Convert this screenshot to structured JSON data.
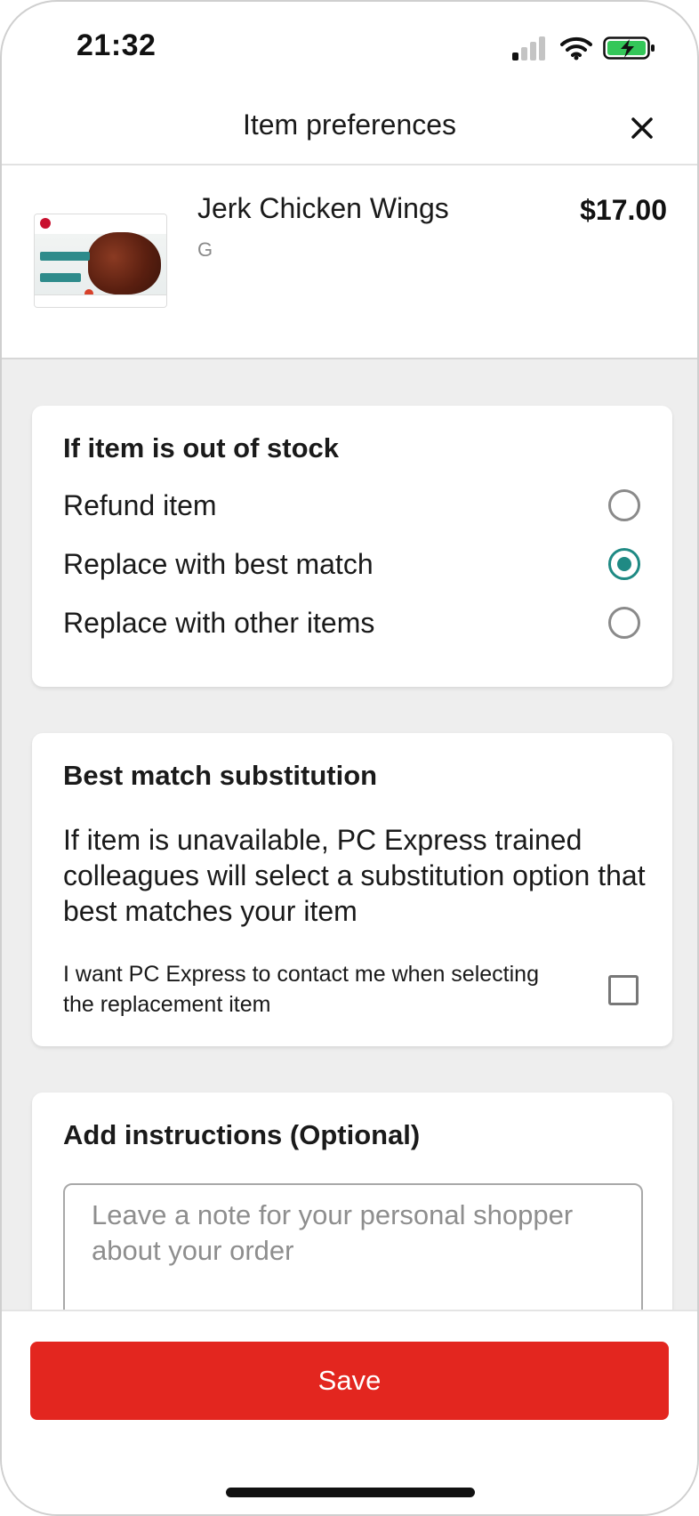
{
  "status_bar": {
    "time": "21:32",
    "icons": [
      "cellular-signal-icon",
      "wifi-icon",
      "battery-charging-icon"
    ]
  },
  "header": {
    "title": "Item preferences",
    "close_icon": "close-icon"
  },
  "product": {
    "name": "Jerk Chicken Wings",
    "unit": "G",
    "price": "$17.00"
  },
  "out_of_stock": {
    "title": "If item is out of stock",
    "options": [
      {
        "label": "Refund item",
        "selected": false
      },
      {
        "label": "Replace with best match",
        "selected": true
      },
      {
        "label": "Replace with other items",
        "selected": false
      }
    ]
  },
  "best_match": {
    "title": "Best match substitution",
    "description": "If item is unavailable, PC Express trained colleagues will select a substitution option that best matches your item",
    "contact_label": "I want PC Express to contact me when selecting the replacement item",
    "contact_checked": false
  },
  "instructions": {
    "title": "Add instructions (Optional)",
    "placeholder": "Leave a note for your personal shopper about your order",
    "value": ""
  },
  "footer": {
    "save_label": "Save"
  },
  "colors": {
    "accent_teal": "#1f8a84",
    "save_red": "#e3261f",
    "battery_green": "#34c759",
    "background_gray": "#eeeeee"
  }
}
